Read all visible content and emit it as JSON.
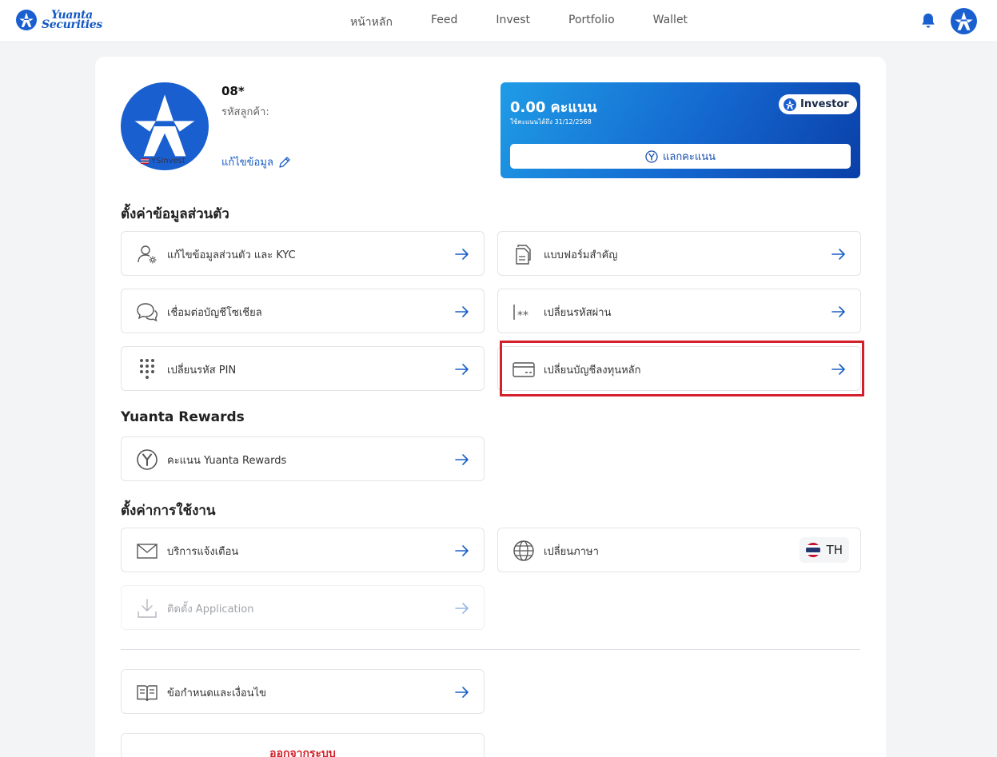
{
  "brand": {
    "line1": "Yuanta",
    "line2": "Securities",
    "color": "#1358c4"
  },
  "nav": [
    "หน้าหลัก",
    "Feed",
    "Invest",
    "Portfolio",
    "Wallet"
  ],
  "profile": {
    "account_id": "08*",
    "customer_code_label": "รหัสลูกค้า:",
    "ysinvest_label": "YSinvest",
    "edit_label": "แก้ไขข้อมูล"
  },
  "points": {
    "value": "0.00 คะแนน",
    "expiry": "ใช้คะแนนได้ถึง 31/12/2568",
    "tier": "Investor",
    "redeem_label": "แลกคะแนน"
  },
  "sections": {
    "personal": "ตั้งค่าข้อมูลส่วนตัว",
    "rewards": "Yuanta Rewards",
    "usage": "ตั้งค่าการใช้งาน"
  },
  "items": {
    "kyc": "แก้ไขข้อมูลส่วนตัว และ KYC",
    "forms": "แบบฟอร์มสำคัญ",
    "social": "เชื่อมต่อบัญชีโซเชียล",
    "password": "เปลี่ยนรหัสผ่าน",
    "pin": "เปลี่ยนรหัส PIN",
    "bank": "เปลี่ยนบัญชีลงทุนหลัก",
    "rewards": "คะแนน Yuanta Rewards",
    "notify": "บริการแจ้งเตือน",
    "language": "เปลี่ยนภาษา",
    "language_value": "TH",
    "install": "ติดตั้ง Application",
    "terms": "ข้อกำหนดและเงื่อนไข"
  },
  "logout_label": "ออกจากระบบ",
  "colors": {
    "accent": "#1a5fc7",
    "danger": "#d4202b"
  }
}
